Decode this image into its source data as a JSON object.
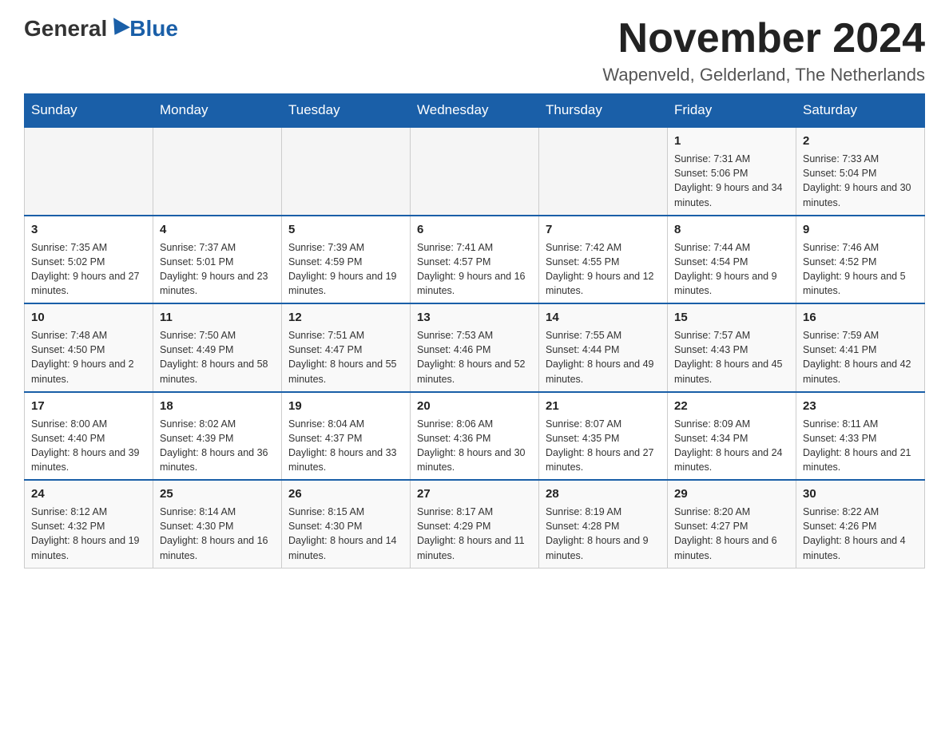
{
  "header": {
    "logo_general": "General",
    "logo_blue": "Blue",
    "title": "November 2024",
    "location": "Wapenveld, Gelderland, The Netherlands"
  },
  "days_of_week": [
    "Sunday",
    "Monday",
    "Tuesday",
    "Wednesday",
    "Thursday",
    "Friday",
    "Saturday"
  ],
  "weeks": [
    [
      {
        "day": "",
        "info": ""
      },
      {
        "day": "",
        "info": ""
      },
      {
        "day": "",
        "info": ""
      },
      {
        "day": "",
        "info": ""
      },
      {
        "day": "",
        "info": ""
      },
      {
        "day": "1",
        "info": "Sunrise: 7:31 AM\nSunset: 5:06 PM\nDaylight: 9 hours and 34 minutes."
      },
      {
        "day": "2",
        "info": "Sunrise: 7:33 AM\nSunset: 5:04 PM\nDaylight: 9 hours and 30 minutes."
      }
    ],
    [
      {
        "day": "3",
        "info": "Sunrise: 7:35 AM\nSunset: 5:02 PM\nDaylight: 9 hours and 27 minutes."
      },
      {
        "day": "4",
        "info": "Sunrise: 7:37 AM\nSunset: 5:01 PM\nDaylight: 9 hours and 23 minutes."
      },
      {
        "day": "5",
        "info": "Sunrise: 7:39 AM\nSunset: 4:59 PM\nDaylight: 9 hours and 19 minutes."
      },
      {
        "day": "6",
        "info": "Sunrise: 7:41 AM\nSunset: 4:57 PM\nDaylight: 9 hours and 16 minutes."
      },
      {
        "day": "7",
        "info": "Sunrise: 7:42 AM\nSunset: 4:55 PM\nDaylight: 9 hours and 12 minutes."
      },
      {
        "day": "8",
        "info": "Sunrise: 7:44 AM\nSunset: 4:54 PM\nDaylight: 9 hours and 9 minutes."
      },
      {
        "day": "9",
        "info": "Sunrise: 7:46 AM\nSunset: 4:52 PM\nDaylight: 9 hours and 5 minutes."
      }
    ],
    [
      {
        "day": "10",
        "info": "Sunrise: 7:48 AM\nSunset: 4:50 PM\nDaylight: 9 hours and 2 minutes."
      },
      {
        "day": "11",
        "info": "Sunrise: 7:50 AM\nSunset: 4:49 PM\nDaylight: 8 hours and 58 minutes."
      },
      {
        "day": "12",
        "info": "Sunrise: 7:51 AM\nSunset: 4:47 PM\nDaylight: 8 hours and 55 minutes."
      },
      {
        "day": "13",
        "info": "Sunrise: 7:53 AM\nSunset: 4:46 PM\nDaylight: 8 hours and 52 minutes."
      },
      {
        "day": "14",
        "info": "Sunrise: 7:55 AM\nSunset: 4:44 PM\nDaylight: 8 hours and 49 minutes."
      },
      {
        "day": "15",
        "info": "Sunrise: 7:57 AM\nSunset: 4:43 PM\nDaylight: 8 hours and 45 minutes."
      },
      {
        "day": "16",
        "info": "Sunrise: 7:59 AM\nSunset: 4:41 PM\nDaylight: 8 hours and 42 minutes."
      }
    ],
    [
      {
        "day": "17",
        "info": "Sunrise: 8:00 AM\nSunset: 4:40 PM\nDaylight: 8 hours and 39 minutes."
      },
      {
        "day": "18",
        "info": "Sunrise: 8:02 AM\nSunset: 4:39 PM\nDaylight: 8 hours and 36 minutes."
      },
      {
        "day": "19",
        "info": "Sunrise: 8:04 AM\nSunset: 4:37 PM\nDaylight: 8 hours and 33 minutes."
      },
      {
        "day": "20",
        "info": "Sunrise: 8:06 AM\nSunset: 4:36 PM\nDaylight: 8 hours and 30 minutes."
      },
      {
        "day": "21",
        "info": "Sunrise: 8:07 AM\nSunset: 4:35 PM\nDaylight: 8 hours and 27 minutes."
      },
      {
        "day": "22",
        "info": "Sunrise: 8:09 AM\nSunset: 4:34 PM\nDaylight: 8 hours and 24 minutes."
      },
      {
        "day": "23",
        "info": "Sunrise: 8:11 AM\nSunset: 4:33 PM\nDaylight: 8 hours and 21 minutes."
      }
    ],
    [
      {
        "day": "24",
        "info": "Sunrise: 8:12 AM\nSunset: 4:32 PM\nDaylight: 8 hours and 19 minutes."
      },
      {
        "day": "25",
        "info": "Sunrise: 8:14 AM\nSunset: 4:30 PM\nDaylight: 8 hours and 16 minutes."
      },
      {
        "day": "26",
        "info": "Sunrise: 8:15 AM\nSunset: 4:30 PM\nDaylight: 8 hours and 14 minutes."
      },
      {
        "day": "27",
        "info": "Sunrise: 8:17 AM\nSunset: 4:29 PM\nDaylight: 8 hours and 11 minutes."
      },
      {
        "day": "28",
        "info": "Sunrise: 8:19 AM\nSunset: 4:28 PM\nDaylight: 8 hours and 9 minutes."
      },
      {
        "day": "29",
        "info": "Sunrise: 8:20 AM\nSunset: 4:27 PM\nDaylight: 8 hours and 6 minutes."
      },
      {
        "day": "30",
        "info": "Sunrise: 8:22 AM\nSunset: 4:26 PM\nDaylight: 8 hours and 4 minutes."
      }
    ]
  ]
}
